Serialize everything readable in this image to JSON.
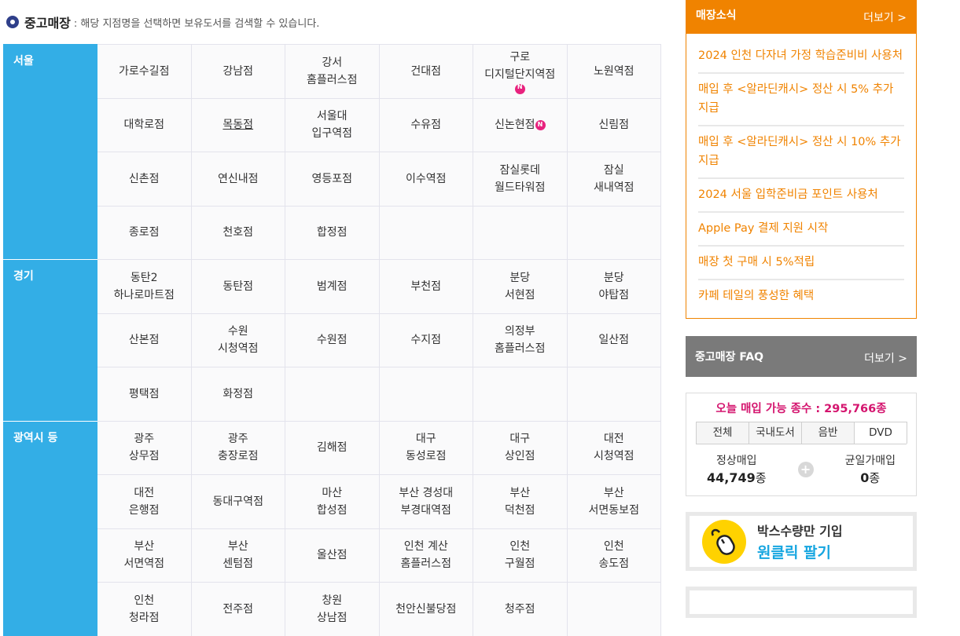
{
  "heading": {
    "title": "중고매장",
    "description": ": 해당 지점명을 선택하면 보유도서를 검색할 수 있습니다."
  },
  "regions": [
    {
      "name": "서울",
      "rows": [
        [
          {
            "name": "가로수길점"
          },
          {
            "name": "강남점"
          },
          {
            "name": "강서\n홈플러스점"
          },
          {
            "name": "건대점"
          },
          {
            "name": "구로\n디지털단지역점",
            "badge": "N",
            "badge_block": true
          },
          {
            "name": "노원역점"
          }
        ],
        [
          {
            "name": "대학로점"
          },
          {
            "name": "목동점",
            "underline": true
          },
          {
            "name": "서울대\n입구역점"
          },
          {
            "name": "수유점"
          },
          {
            "name": "신논현점",
            "badge": "N"
          },
          {
            "name": "신림점"
          }
        ],
        [
          {
            "name": "신촌점"
          },
          {
            "name": "연신내점"
          },
          {
            "name": "영등포점"
          },
          {
            "name": "이수역점"
          },
          {
            "name": "잠실롯데\n월드타워점"
          },
          {
            "name": "잠실\n새내역점"
          }
        ],
        [
          {
            "name": "종로점"
          },
          {
            "name": "천호점"
          },
          {
            "name": "합정점"
          },
          {
            "name": ""
          },
          {
            "name": ""
          },
          {
            "name": ""
          }
        ]
      ]
    },
    {
      "name": "경기",
      "rows": [
        [
          {
            "name": "동탄2\n하나로마트점"
          },
          {
            "name": "동탄점"
          },
          {
            "name": "범계점"
          },
          {
            "name": "부천점"
          },
          {
            "name": "분당\n서현점"
          },
          {
            "name": "분당\n야탑점"
          }
        ],
        [
          {
            "name": "산본점"
          },
          {
            "name": "수원\n시청역점"
          },
          {
            "name": "수원점"
          },
          {
            "name": "수지점"
          },
          {
            "name": "의정부\n홈플러스점"
          },
          {
            "name": "일산점"
          }
        ],
        [
          {
            "name": "평택점"
          },
          {
            "name": "화정점"
          },
          {
            "name": ""
          },
          {
            "name": ""
          },
          {
            "name": ""
          },
          {
            "name": ""
          }
        ]
      ]
    },
    {
      "name": "광역시 등",
      "rows": [
        [
          {
            "name": "광주\n상무점"
          },
          {
            "name": "광주\n충장로점"
          },
          {
            "name": "김해점"
          },
          {
            "name": "대구\n동성로점"
          },
          {
            "name": "대구\n상인점"
          },
          {
            "name": "대전\n시청역점"
          }
        ],
        [
          {
            "name": "대전\n은행점"
          },
          {
            "name": "동대구역점"
          },
          {
            "name": "마산\n합성점"
          },
          {
            "name": "부산 경성대\n부경대역점"
          },
          {
            "name": "부산\n덕천점"
          },
          {
            "name": "부산\n서면동보점"
          }
        ],
        [
          {
            "name": "부산\n서면역점"
          },
          {
            "name": "부산\n센텀점"
          },
          {
            "name": "울산점"
          },
          {
            "name": "인천 계산\n홈플러스점"
          },
          {
            "name": "인천\n구월점"
          },
          {
            "name": "인천\n송도점"
          }
        ],
        [
          {
            "name": "인천\n청라점"
          },
          {
            "name": "전주점"
          },
          {
            "name": "창원\n상남점"
          },
          {
            "name": "천안신불당점"
          },
          {
            "name": "청주점"
          },
          {
            "name": ""
          }
        ]
      ]
    }
  ],
  "news": {
    "title": "매장소식",
    "more": "더보기 >",
    "items": [
      "2024 인천 다자녀 가정 학습준비비 사용처",
      "매입 후 <알라딘캐시> 정산 시 5% 추가 지급",
      "매입 후 <알라딘캐시> 정산 시 10% 추가 지급",
      "2024 서울 입학준비금 포인트 사용처",
      "Apple Pay 결제 지원 시작",
      "매장 첫 구매 시 5%적립",
      "카페 테일의 풍성한 혜택"
    ]
  },
  "faq": {
    "title": "중고매장 FAQ",
    "more": "더보기 >"
  },
  "buy": {
    "count_text": "오늘 매입 가능 종수 : 295,766종",
    "tabs": [
      "전체",
      "국내도서",
      "음반",
      "DVD"
    ],
    "active_tab": 3,
    "regular_label": "정상매입",
    "regular_value": "44,749",
    "flat_label": "균일가매입",
    "flat_value": "0",
    "unit": "종"
  },
  "banner": {
    "line1": "박스수량만 기입",
    "line2": "원클릭 팔기"
  },
  "colors": {
    "region_bg": "#33aee6",
    "news_accent": "#f08300",
    "faq_bg": "#7a7a7a",
    "count_text": "#d4146e",
    "banner_circle": "#ffd200",
    "banner_blue": "#17a6e0",
    "badge": "#e8227e"
  }
}
